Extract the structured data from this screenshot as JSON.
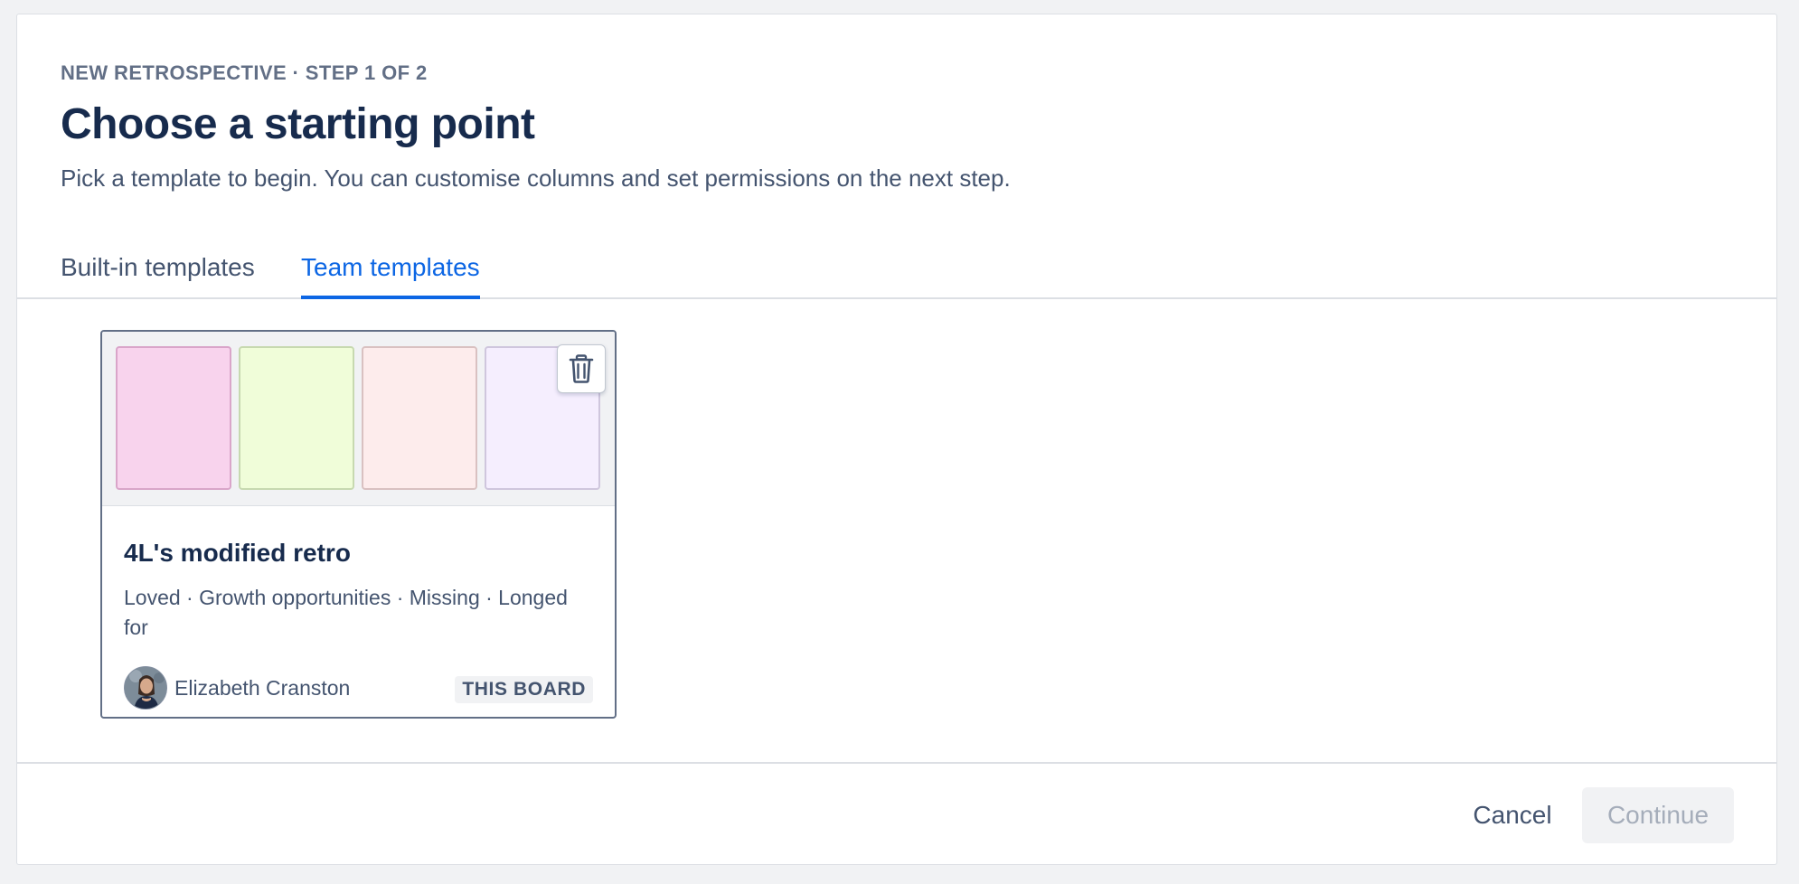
{
  "header": {
    "eyebrow": "NEW RETROSPECTIVE · STEP 1 OF 2",
    "title": "Choose a starting point",
    "subtitle": "Pick a template to begin. You can customise columns and set permissions on the next step."
  },
  "tabs": [
    {
      "label": "Built-in templates",
      "active": false
    },
    {
      "label": "Team templates",
      "active": true
    }
  ],
  "templates": [
    {
      "name": "4L's modified retro",
      "columns": "Loved · Growth opportunities · Missing · Longed for",
      "column_colors": [
        "#f8d3ed",
        "#f0fdd9",
        "#fdecec",
        "#f5eefe"
      ],
      "author": "Elizabeth Cranston",
      "badge": "THIS BOARD",
      "delete_icon": "trash-icon"
    }
  ],
  "footer": {
    "cancel_label": "Cancel",
    "continue_label": "Continue",
    "continue_disabled": true
  },
  "colors": {
    "accent": "#0c66e4",
    "text_primary": "#172b4d",
    "text_subtle": "#44546f"
  }
}
